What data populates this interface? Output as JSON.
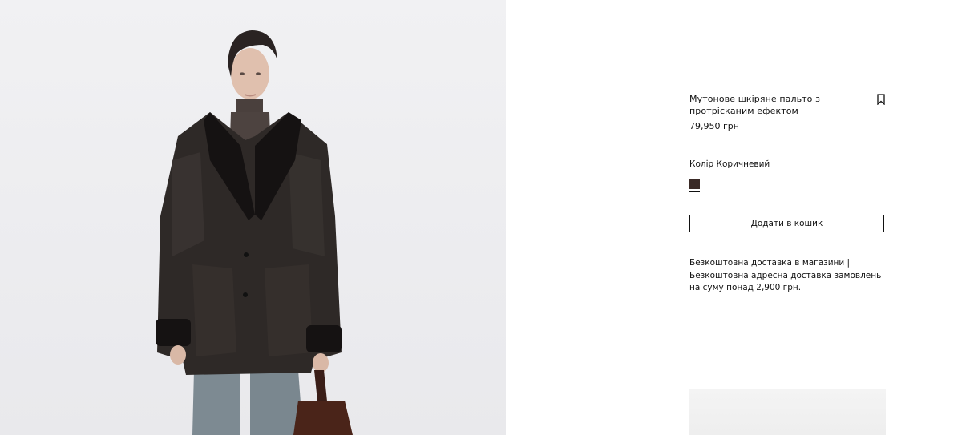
{
  "product": {
    "title": "Мутонове шкіряне пальто з протрісканим ефектом",
    "price": "79,950 грн",
    "color_label": "Колір Коричневий",
    "swatch_color": "#3a2a26",
    "add_to_cart": "Додати в кошик",
    "shipping_info": "Безкоштовна доставка в магазини |  Безкоштовна адресна доставка замовлень на суму понад 2,900 грн."
  },
  "icons": {
    "bookmark": "bookmark-icon"
  }
}
